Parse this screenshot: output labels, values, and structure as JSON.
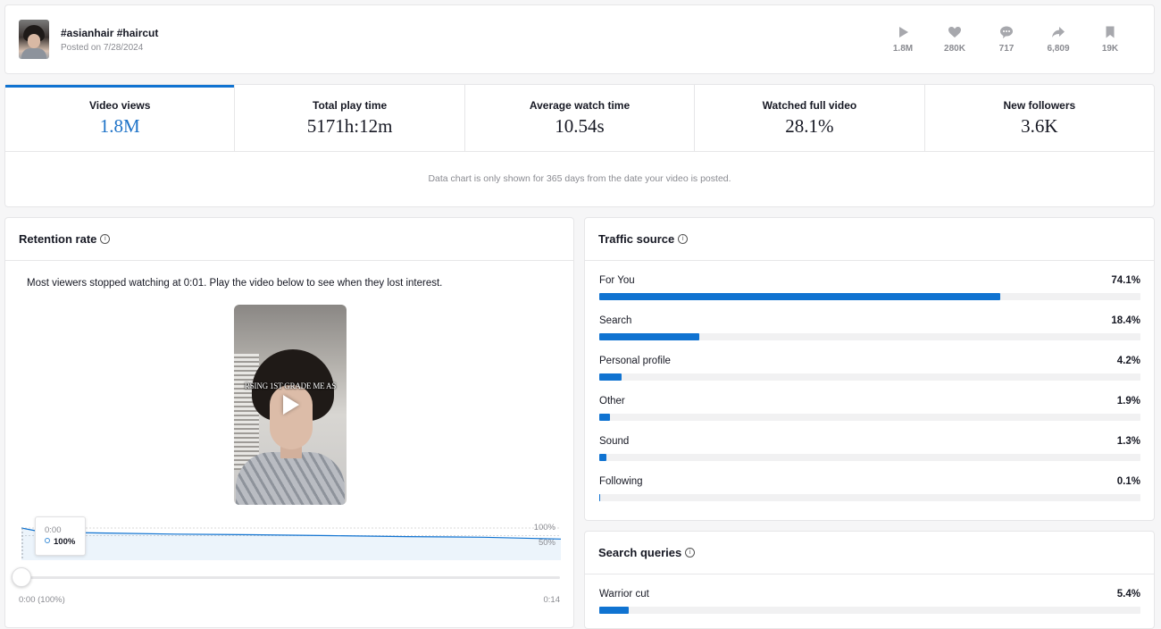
{
  "header": {
    "title": "#asianhair #haircut",
    "posted": "Posted on 7/28/2024",
    "stats": [
      {
        "icon": "play-icon",
        "value": "1.8M"
      },
      {
        "icon": "heart-icon",
        "value": "280K"
      },
      {
        "icon": "comment-icon",
        "value": "717"
      },
      {
        "icon": "share-icon",
        "value": "6,809"
      },
      {
        "icon": "bookmark-icon",
        "value": "19K"
      }
    ]
  },
  "metrics": {
    "tabs": [
      {
        "label": "Video views",
        "value": "1.8M",
        "active": true
      },
      {
        "label": "Total play time",
        "value": "5171h:12m"
      },
      {
        "label": "Average watch time",
        "value": "10.54s"
      },
      {
        "label": "Watched full video",
        "value": "28.1%"
      },
      {
        "label": "New followers",
        "value": "3.6K"
      }
    ],
    "note": "Data chart is only shown for 365 days from the date your video is posted."
  },
  "retention": {
    "title": "Retention rate",
    "message": "Most viewers stopped watching at 0:01. Play the video below to see when they lost interest.",
    "video_caption": "RSING 1ST GRADE ME AS",
    "tooltip_time": "0:00",
    "tooltip_value": "100%",
    "label_100": "100%",
    "label_50": "50%",
    "time_start": "0:00 (100%)",
    "time_end": "0:14",
    "accent": "#1073d1"
  },
  "chart_data": {
    "type": "area",
    "x": [
      0,
      0.5,
      1,
      2,
      4,
      6,
      8,
      10,
      12,
      14
    ],
    "values": [
      100,
      88,
      86,
      84,
      80,
      78,
      75,
      72,
      70,
      64
    ],
    "ylim": [
      0,
      100
    ],
    "xlabel": "",
    "ylabel": ""
  },
  "traffic": {
    "title": "Traffic source",
    "sources": [
      {
        "name": "For You",
        "pct": "74.1%",
        "value": 74.1
      },
      {
        "name": "Search",
        "pct": "18.4%",
        "value": 18.4
      },
      {
        "name": "Personal profile",
        "pct": "4.2%",
        "value": 4.2
      },
      {
        "name": "Other",
        "pct": "1.9%",
        "value": 1.9
      },
      {
        "name": "Sound",
        "pct": "1.3%",
        "value": 1.3
      },
      {
        "name": "Following",
        "pct": "0.1%",
        "value": 0.1
      }
    ]
  },
  "search": {
    "title": "Search queries",
    "queries": [
      {
        "name": "Warrior cut",
        "pct": "5.4%",
        "value": 5.4
      }
    ]
  }
}
